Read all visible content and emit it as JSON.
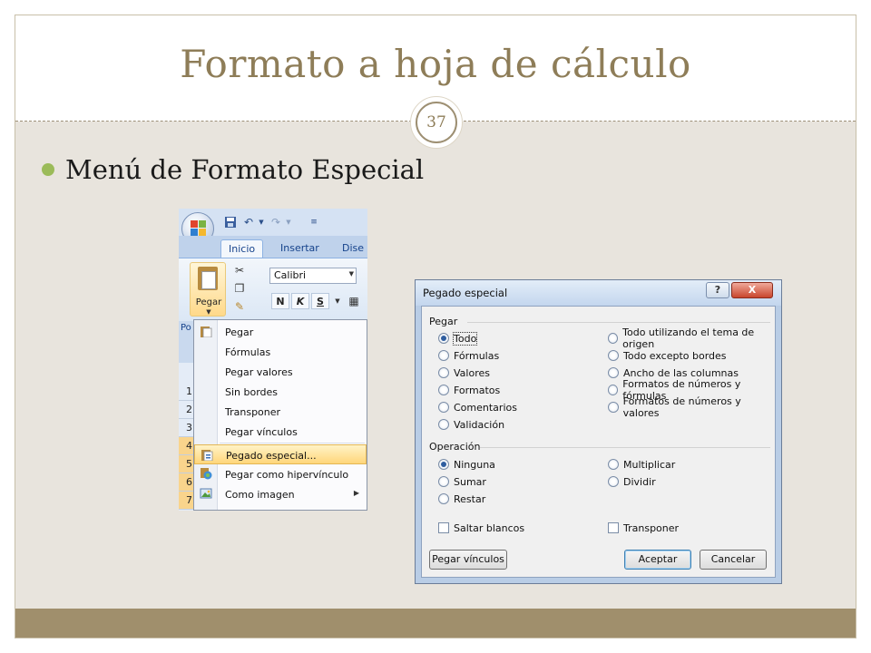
{
  "slide": {
    "title": "Formato a hoja de cálculo",
    "page_number": "37",
    "bullet": "Menú de Formato Especial",
    "colors": {
      "title": "#8e7d58",
      "content_bg": "#e8e4dd",
      "footer": "#a08f6c",
      "bullet": "#9bbb59"
    }
  },
  "excel": {
    "tabs": [
      "Inicio",
      "Insertar",
      "Dise"
    ],
    "paste_label": "Pegar",
    "font_name": "Calibri",
    "format_buttons": [
      "N",
      "K",
      "S"
    ],
    "group_label": "Po",
    "row_numbers": [
      "1",
      "2",
      "3",
      "4",
      "5",
      "6",
      "7"
    ],
    "paste_menu": [
      {
        "label": "Pegar",
        "icon": "paste-icon"
      },
      {
        "label": "Fórmulas",
        "icon": ""
      },
      {
        "label": "Pegar valores",
        "icon": ""
      },
      {
        "label": "Sin bordes",
        "icon": ""
      },
      {
        "label": "Transponer",
        "icon": ""
      },
      {
        "label": "Pegar vínculos",
        "icon": ""
      },
      {
        "label": "Pegado especial...",
        "icon": "paste-special-icon"
      },
      {
        "label": "Pegar como hipervínculo",
        "icon": "hyperlink-icon"
      },
      {
        "label": "Como imagen",
        "icon": "picture-icon"
      }
    ]
  },
  "dialog": {
    "title": "Pegado especial",
    "help": "?",
    "close": "X",
    "paste_group": "Pegar",
    "paste_left": [
      "Todo",
      "Fórmulas",
      "Valores",
      "Formatos",
      "Comentarios",
      "Validación"
    ],
    "paste_right": [
      "Todo utilizando el tema de origen",
      "Todo excepto bordes",
      "Ancho de las columnas",
      "Formatos de números y fórmulas",
      "Formatos de números y valores"
    ],
    "operation_group": "Operación",
    "op_left": [
      "Ninguna",
      "Sumar",
      "Restar"
    ],
    "op_right": [
      "Multiplicar",
      "Dividir"
    ],
    "skip_blanks": "Saltar blancos",
    "transpose": "Transponer",
    "paste_links_button": "Pegar vínculos",
    "ok_button": "Aceptar",
    "cancel_button": "Cancelar"
  }
}
